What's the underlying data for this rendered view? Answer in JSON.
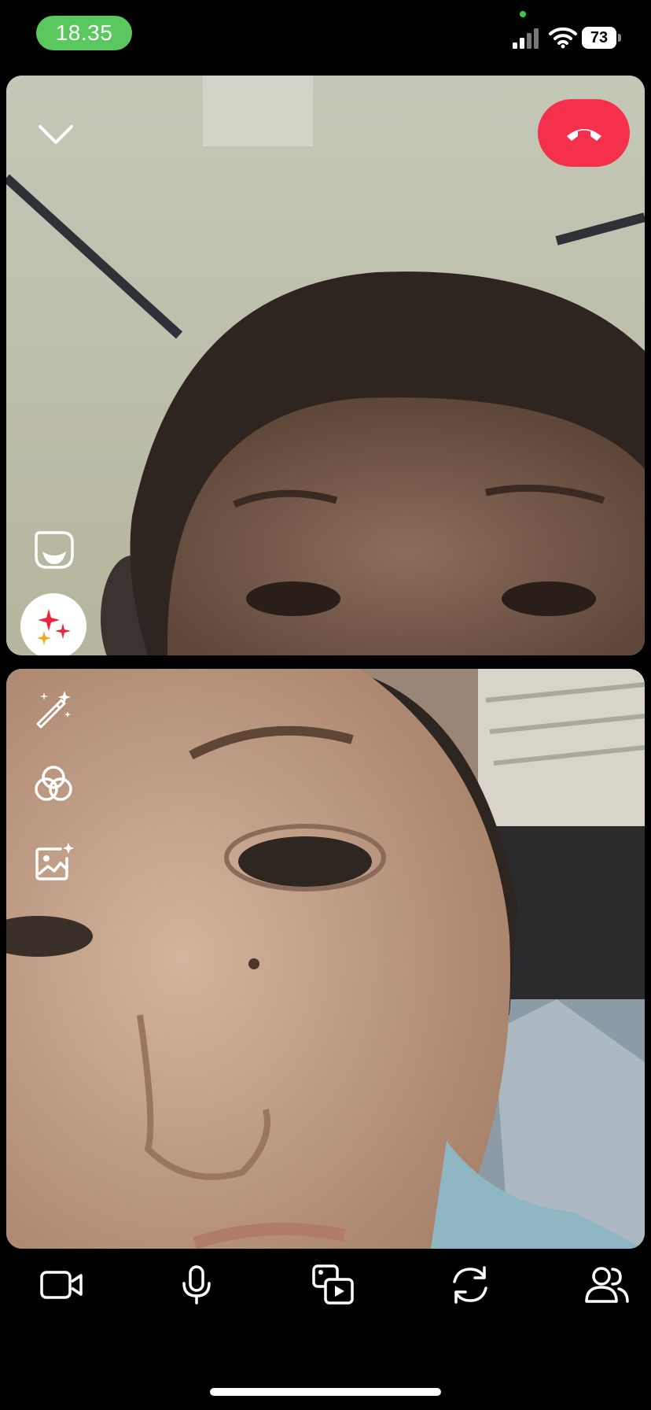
{
  "status_bar": {
    "time": "18.35",
    "battery": "73"
  },
  "call": {
    "controls": {
      "collapse_icon": "chevron-down-icon",
      "end_call_icon": "phone-hangup-icon",
      "sticker_icon": "sticker-icon",
      "effects_icon": "sparkles-icon",
      "magic_icon": "magic-wand-icon",
      "filter_icon": "color-filter-icon",
      "background_icon": "background-image-icon"
    },
    "bottom_bar": [
      {
        "name": "camera",
        "icon": "video-camera-icon"
      },
      {
        "name": "microphone",
        "icon": "microphone-icon"
      },
      {
        "name": "share-media",
        "icon": "share-media-icon"
      },
      {
        "name": "flip-camera",
        "icon": "flip-camera-icon"
      },
      {
        "name": "participants",
        "icon": "participants-icon"
      }
    ]
  },
  "colors": {
    "end_call": "#f4304a",
    "time_pill": "#5ac85e",
    "effects_red": "#e8273f",
    "effects_orange": "#f5a623"
  }
}
